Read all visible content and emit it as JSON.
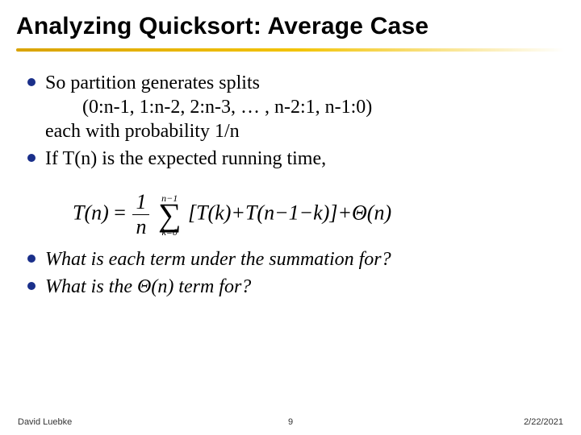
{
  "title": "Analyzing Quicksort: Average Case",
  "bullets1": [
    {
      "line1": "So partition generates splits",
      "line2": "(0:n-1,  1:n-2,  2:n-3,  … ,  n-2:1,  n-1:0)",
      "line3": "each with probability 1/n"
    },
    {
      "line1": "If T(n) is the expected running time,"
    }
  ],
  "formula": {
    "lhs": "T(n)",
    "eq": "=",
    "frac_num": "1",
    "frac_den": "n",
    "sum_top": "n−1",
    "sum_bot": "k=0",
    "body": "[T(k)+T(n−1−k)]+Θ(n)"
  },
  "bullets2": [
    {
      "text": "What is each term under the summation for?"
    },
    {
      "text": "What is the Θ(n) term for?"
    }
  ],
  "footer": {
    "author": "David Luebke",
    "page": "9",
    "date": "2/22/2021"
  }
}
